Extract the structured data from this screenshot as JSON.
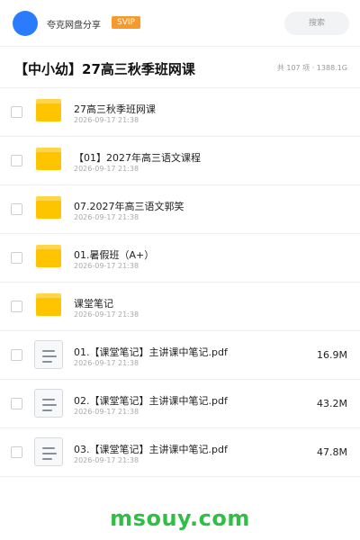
{
  "header": {
    "username": "夸克网盘分享",
    "vip_badge": "SVIP",
    "search_placeholder": "搜索"
  },
  "folder": {
    "title": "【中小幼】27高三秋季班网课",
    "summary": "共 107 项 · 1388.1G"
  },
  "items": [
    {
      "type": "folder",
      "name": "27高三秋季班网课",
      "date": "2026-09-17 21:38",
      "size": ""
    },
    {
      "type": "folder",
      "name": "【01】2027年高三语文课程",
      "date": "2026-09-17 21:38",
      "size": ""
    },
    {
      "type": "folder",
      "name": "07.2027年高三语文郭笑",
      "date": "2026-09-17 21:38",
      "size": ""
    },
    {
      "type": "folder",
      "name": "01.暑假班（A+）",
      "date": "2026-09-17 21:38",
      "size": ""
    },
    {
      "type": "folder",
      "name": "课堂笔记",
      "date": "2026-09-17 21:38",
      "size": ""
    },
    {
      "type": "file",
      "name": "01.【课堂笔记】主讲课中笔记.pdf",
      "date": "2026-09-17 21:38",
      "size": "16.9M"
    },
    {
      "type": "file",
      "name": "02.【课堂笔记】主讲课中笔记.pdf",
      "date": "2026-09-17 21:38",
      "size": "43.2M"
    },
    {
      "type": "file",
      "name": "03.【课堂笔记】主讲课中笔记.pdf",
      "date": "2026-09-17 21:38",
      "size": "47.8M"
    }
  ],
  "watermark": "msouy.com",
  "colors": {
    "avatar": "#2b7bff",
    "vip": "#f79a2e",
    "folder": "#ffc400",
    "watermark": "#2fbf45"
  }
}
